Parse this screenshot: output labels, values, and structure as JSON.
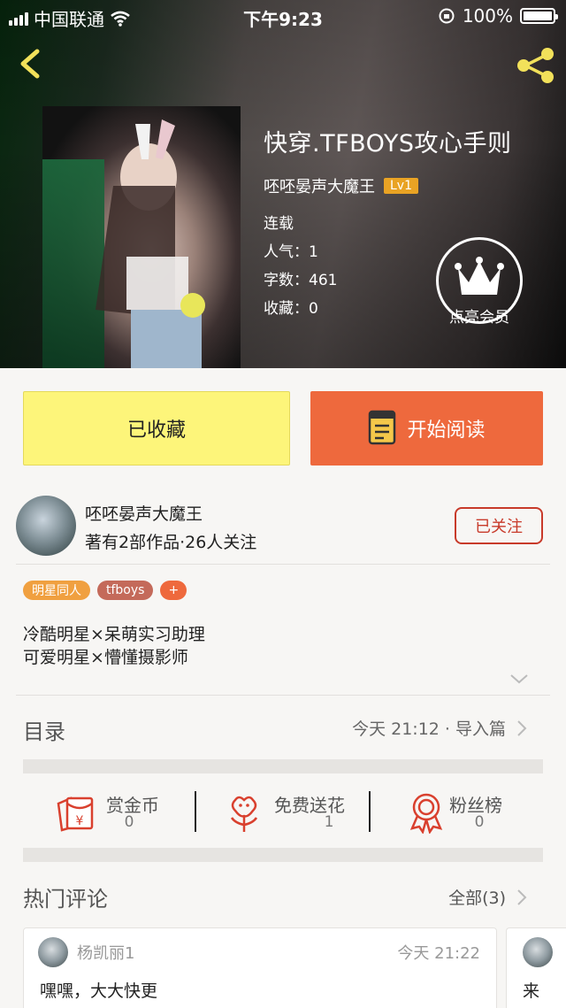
{
  "status_bar": {
    "carrier": "中国联通",
    "time": "下午9:23",
    "battery": "100%"
  },
  "book": {
    "title": "快穿.TFBOYS攻心手则",
    "author": "呸呸晏声大魔王",
    "level": "Lv1",
    "status": "连载",
    "popularity": "人气：1",
    "word_count": "字数：461",
    "favorites": "收藏：0"
  },
  "vip": {
    "label": "点亮会员"
  },
  "buttons": {
    "favorited": "已收藏",
    "start_reading": "开始阅读"
  },
  "author_card": {
    "name": "呸呸晏声大魔王",
    "stats": "著有2部作品·26人关注",
    "follow": "已关注"
  },
  "tags": [
    "明星同人",
    "tfboys",
    "+"
  ],
  "description": {
    "line1": "冷酷明星×呆萌实习助理",
    "line2": "可爱明星×懵懂摄影师"
  },
  "toc": {
    "label": "目录",
    "update": "今天 21:12 · 导入篇"
  },
  "actions": [
    {
      "label": "赏金币",
      "count": "0"
    },
    {
      "label": "免费送花",
      "count": "1"
    },
    {
      "label": "粉丝榜",
      "count": "0"
    }
  ],
  "comments": {
    "label": "热门评论",
    "all": "全部(3)",
    "items": [
      {
        "user": "杨凯丽1",
        "time": "今天 21:22",
        "text": "嘿嘿，大大快更"
      },
      {
        "user": "",
        "time": "",
        "text": "来"
      }
    ]
  },
  "colors": {
    "accent_orange": "#ee693d",
    "fav_yellow": "#fdf57a",
    "follow_red": "#c83a2a",
    "level_badge": "#e9a324",
    "icon_red": "#d9402e"
  }
}
